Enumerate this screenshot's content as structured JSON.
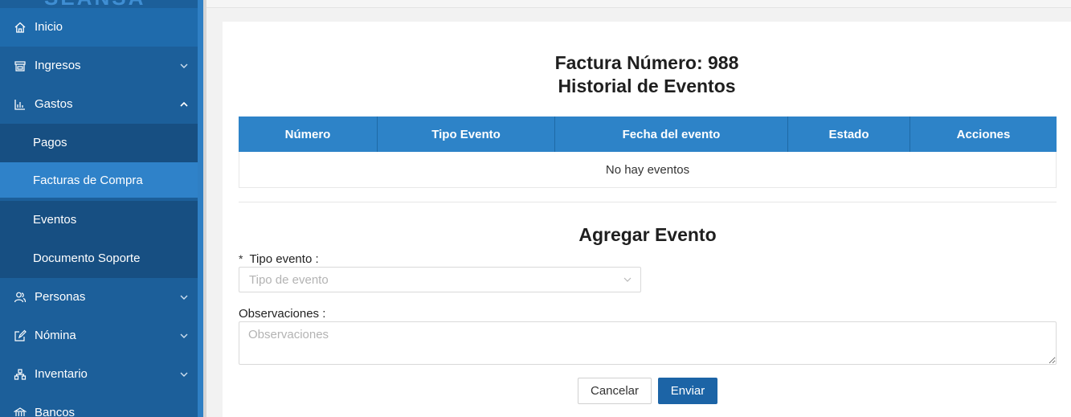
{
  "sidebar": {
    "logo": "SEANSA",
    "items": [
      {
        "label": "Inicio",
        "icon": "home-icon"
      },
      {
        "label": "Ingresos",
        "icon": "store-icon"
      },
      {
        "label": "Gastos",
        "icon": "bar-chart-icon"
      },
      {
        "label": "Pagos"
      },
      {
        "label": "Facturas de Compra"
      },
      {
        "label": "Eventos"
      },
      {
        "label": "Documento Soporte"
      },
      {
        "label": "Personas",
        "icon": "people-icon"
      },
      {
        "label": "Nómina",
        "icon": "edit-icon"
      },
      {
        "label": "Inventario",
        "icon": "boxes-icon"
      },
      {
        "label": "Bancos",
        "icon": "bank-icon"
      }
    ]
  },
  "header": {
    "title_line1": "Factura Número: 988",
    "title_line2": "Historial de Eventos"
  },
  "table": {
    "columns": [
      "Número",
      "Tipo Evento",
      "Fecha del evento",
      "Estado",
      "Acciones"
    ],
    "empty_text": "No hay eventos"
  },
  "form": {
    "title": "Agregar Evento",
    "required_mark": "*",
    "tipo_label": "Tipo evento :",
    "tipo_placeholder": "Tipo de evento",
    "obs_label": "Observaciones :",
    "obs_placeholder": "Observaciones",
    "cancel_label": "Cancelar",
    "send_label": "Enviar"
  },
  "colors": {
    "sidebar_bg": "#1c5f9a",
    "active_item": "#2f82c9",
    "table_header": "#2d83c8",
    "primary_button": "#1c64a6"
  }
}
